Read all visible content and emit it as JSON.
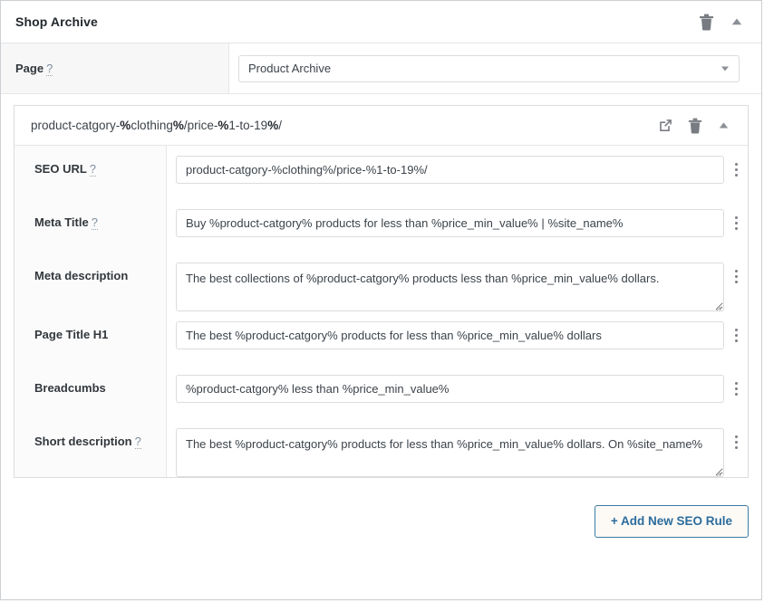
{
  "metabox": {
    "title": "Shop Archive",
    "actions": [
      {
        "name": "delete-icon",
        "label": "Delete"
      },
      {
        "name": "collapse-icon",
        "label": "Toggle panel"
      }
    ]
  },
  "page_row": {
    "label": "Page",
    "help": "?",
    "select": {
      "value": "Product Archive",
      "options": [
        "Product Archive"
      ]
    }
  },
  "rule": {
    "title_parts": [
      {
        "text": "product-catgory-",
        "bold": false
      },
      {
        "text": "%",
        "bold": true
      },
      {
        "text": "clothing",
        "bold": false
      },
      {
        "text": "%",
        "bold": true
      },
      {
        "text": "/price-",
        "bold": false
      },
      {
        "text": "%",
        "bold": true
      },
      {
        "text": "1-to-19",
        "bold": false
      },
      {
        "text": "%",
        "bold": true
      },
      {
        "text": "/",
        "bold": false
      }
    ],
    "title_plain": "product-catgory-%clothing%/price-%1-to-19%/",
    "actions": [
      {
        "name": "external-link-icon",
        "label": "Open"
      },
      {
        "name": "delete-icon",
        "label": "Delete"
      },
      {
        "name": "collapse-icon",
        "label": "Toggle rule"
      }
    ],
    "fields": [
      {
        "key": "seo_url",
        "label": "SEO URL",
        "help": "?",
        "type": "text",
        "value": "product-catgory-%clothing%/price-%1-to-19%/"
      },
      {
        "key": "meta_title",
        "label": "Meta Title",
        "help": "?",
        "type": "text",
        "value": "Buy %product-catgory% products for less than %price_min_value% | %site_name%"
      },
      {
        "key": "meta_description",
        "label": "Meta description",
        "help": "",
        "type": "textarea",
        "value": "The best collections of %product-catgory% products less than %price_min_value% dollars."
      },
      {
        "key": "page_title_h1",
        "label": "Page Title H1",
        "help": "",
        "type": "text",
        "value": "The best %product-catgory% products for less than %price_min_value% dollars"
      },
      {
        "key": "breadcumbs",
        "label": "Breadcumbs",
        "help": "",
        "type": "text",
        "value": "%product-catgory% less than %price_min_value%"
      },
      {
        "key": "short_description",
        "label": "Short description",
        "help": "?",
        "type": "textarea",
        "value": "The best %product-catgory% products for less than %price_min_value% dollars. On %site_name%"
      }
    ]
  },
  "footer": {
    "add_rule_label": "+ Add New SEO Rule"
  },
  "colors": {
    "accent": "#2b6c9c",
    "button_border": "#3a7ca8",
    "button_bg": "#fdfaf6",
    "panel_border": "#dcdcde",
    "text": "#32373c",
    "icon": "#787c82"
  }
}
